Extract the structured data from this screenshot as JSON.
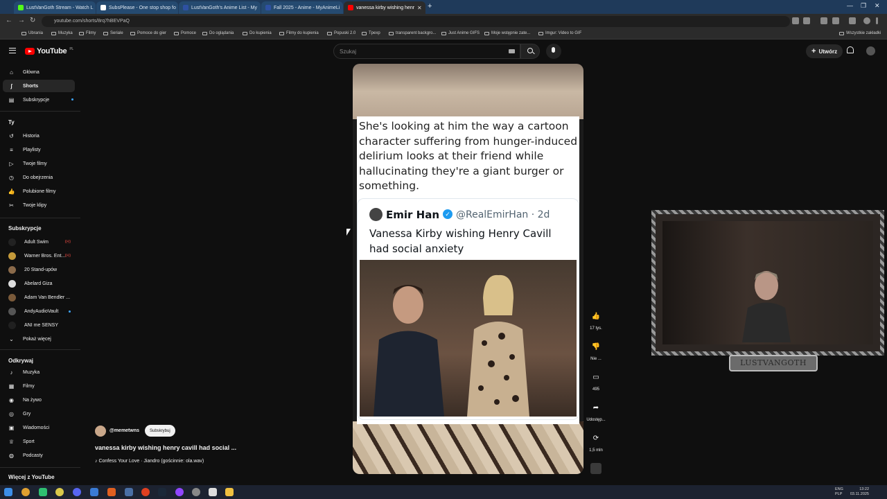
{
  "browser": {
    "tabs": [
      {
        "label": "LustVanGoth Stream - Watch L",
        "color": "#53fc18"
      },
      {
        "label": "SubsPlease - One stop shop fo",
        "color": "#ffffff"
      },
      {
        "label": "LustVanGoth's Anime List - My",
        "color": "#2e51a2"
      },
      {
        "label": "Fall 2025 - Anime - MyAnimeLi",
        "color": "#2e51a2"
      },
      {
        "label": "vanessa kirby wishing henr",
        "color": "#ff0000"
      }
    ],
    "url": "youtube.com/shorts/8rq7hBEVPaQ",
    "bookmarks": [
      "Ubrania",
      "Muzyka",
      "Filmy",
      "Seriale",
      "Pomoce do gier",
      "Pomoce",
      "Do oglądania",
      "Do kupienia",
      "Filmy do kupienia",
      "Popuski 2.0",
      "Tpexp",
      "transparent backgro...",
      "Just Anime GIFS",
      "Moje wstępnie zate...",
      "Imgur: Video to GIF"
    ],
    "all_bookmarks": "Wszystkie zakładki"
  },
  "youtube": {
    "logo_text": "YouTube",
    "logo_region": "PL",
    "search_placeholder": "Szukaj",
    "create_label": "Utwórz",
    "nav_main": [
      {
        "label": "Główna",
        "icon": "home-icon",
        "glyph": "⌂"
      },
      {
        "label": "Shorts",
        "icon": "shorts-icon",
        "glyph": "ʃ"
      },
      {
        "label": "Subskrypcje",
        "icon": "subscriptions-icon",
        "glyph": "▤"
      }
    ],
    "you_heading": "Ty",
    "nav_you": [
      {
        "label": "Historia",
        "icon": "history-icon",
        "glyph": "↺"
      },
      {
        "label": "Playlisty",
        "icon": "playlists-icon",
        "glyph": "≡"
      },
      {
        "label": "Twoje filmy",
        "icon": "your-videos-icon",
        "glyph": "▷"
      },
      {
        "label": "Do obejrzenia",
        "icon": "watch-later-icon",
        "glyph": "◷"
      },
      {
        "label": "Polubione filmy",
        "icon": "liked-icon",
        "glyph": "👍"
      },
      {
        "label": "Twoje klipy",
        "icon": "clips-icon",
        "glyph": "✂"
      }
    ],
    "subs_heading": "Subskrypcje",
    "subscriptions": [
      {
        "label": "Adult Swim",
        "color": "#222222",
        "badge": "live"
      },
      {
        "label": "Warner Bros. Ent...",
        "color": "#c49a3a",
        "badge": "live"
      },
      {
        "label": "20 Stand-upów",
        "color": "#8a6a4a",
        "badge": ""
      },
      {
        "label": "Abelard Giza",
        "color": "#dddddd",
        "badge": ""
      },
      {
        "label": "Adam Van Bendler ...",
        "color": "#7a5a3a",
        "badge": ""
      },
      {
        "label": "AndyAudioVault",
        "color": "#555555",
        "badge": "dot"
      },
      {
        "label": "ANI me SENSY",
        "color": "#202020",
        "badge": ""
      }
    ],
    "show_more": "Pokaż więcej",
    "explore_heading": "Odkrywaj",
    "nav_explore": [
      {
        "label": "Muzyka",
        "icon": "music-icon",
        "glyph": "♪"
      },
      {
        "label": "Filmy",
        "icon": "movies-icon",
        "glyph": "▦"
      },
      {
        "label": "Na żywo",
        "icon": "live-icon",
        "glyph": "◉"
      },
      {
        "label": "Gry",
        "icon": "gaming-icon",
        "glyph": "◎"
      },
      {
        "label": "Wiadomości",
        "icon": "news-icon",
        "glyph": "▣"
      },
      {
        "label": "Sport",
        "icon": "sport-icon",
        "glyph": "♕"
      },
      {
        "label": "Podcasty",
        "icon": "podcasts-icon",
        "glyph": "◍"
      }
    ],
    "more_heading": "Więcej z YouTube"
  },
  "short": {
    "caption": "She's looking at him the way a cartoon character suffering from hunger-induced delirium looks at their friend while hallucinating they're a giant burger or something.",
    "quote_name": "Emir Han",
    "quote_handle": "@RealEmirHan · 2d",
    "quote_text": "Vanessa Kirby wishing Henry Cavill had social anxiety",
    "channel": "@memetwns",
    "subscribe_label": "Subskrybuj",
    "title": "vanessa kirby wishing henry cavill had social ...",
    "music": "♪ Confess Your Love · Jiandro (gościnnie: ola.wav)",
    "actions": [
      {
        "name": "like",
        "glyph": "👍",
        "label": "17 tys."
      },
      {
        "name": "dislike",
        "glyph": "👎",
        "label": "Nie ..."
      },
      {
        "name": "comments",
        "glyph": "▭",
        "label": "495"
      },
      {
        "name": "share",
        "glyph": "➦",
        "label": "Udostęp..."
      },
      {
        "name": "remix",
        "glyph": "⟳",
        "label": "1,5 mln"
      }
    ]
  },
  "webcam_label": "LUSTVANGOTH",
  "taskbar": {
    "lang": "ENG\nPLP",
    "time": "13:22",
    "date": "03.11.2025"
  }
}
